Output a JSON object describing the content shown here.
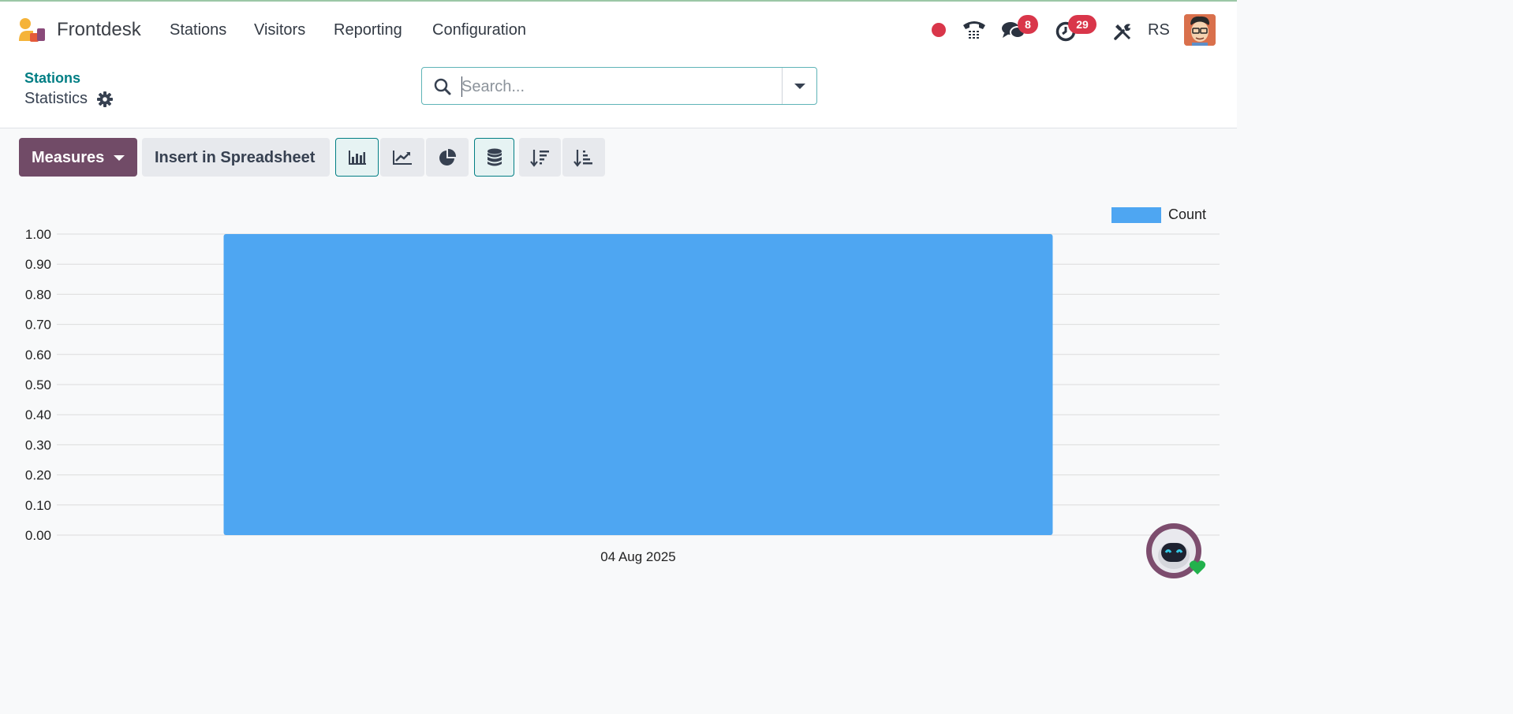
{
  "app": {
    "name": "Frontdesk"
  },
  "menu": [
    {
      "label": "Stations"
    },
    {
      "label": "Visitors"
    },
    {
      "label": "Reporting"
    },
    {
      "label": "Configuration"
    }
  ],
  "systray": {
    "messages_count": "8",
    "activities_count": "29",
    "user_initials": "RS",
    "status_color": "#d9364a"
  },
  "breadcrumb": {
    "parent": "Stations",
    "current": "Statistics"
  },
  "search": {
    "placeholder": "Search...",
    "value": ""
  },
  "toolbar": {
    "measures_label": "Measures",
    "spreadsheet_label": "Insert in Spreadsheet",
    "view_buttons": [
      {
        "icon": "bar-chart-icon",
        "active": true
      },
      {
        "icon": "line-chart-icon",
        "active": false
      },
      {
        "icon": "pie-chart-icon",
        "active": false
      },
      {
        "icon": "stacked-database-icon",
        "active": true
      },
      {
        "icon": "sort-descending-icon",
        "active": false
      },
      {
        "icon": "sort-ascending-icon",
        "active": false
      }
    ]
  },
  "colors": {
    "accent": "#714b67",
    "bar": "#4ea6f2",
    "link": "#017e84"
  },
  "chart_data": {
    "type": "bar",
    "categories": [
      "04 Aug 2025"
    ],
    "series": [
      {
        "name": "Count",
        "values": [
          1.0
        ]
      }
    ],
    "ylim": [
      0,
      1.0
    ],
    "yticks": [
      "0.00",
      "0.10",
      "0.20",
      "0.30",
      "0.40",
      "0.50",
      "0.60",
      "0.70",
      "0.80",
      "0.90",
      "1.00"
    ],
    "grid": true,
    "legend": "top-right"
  }
}
